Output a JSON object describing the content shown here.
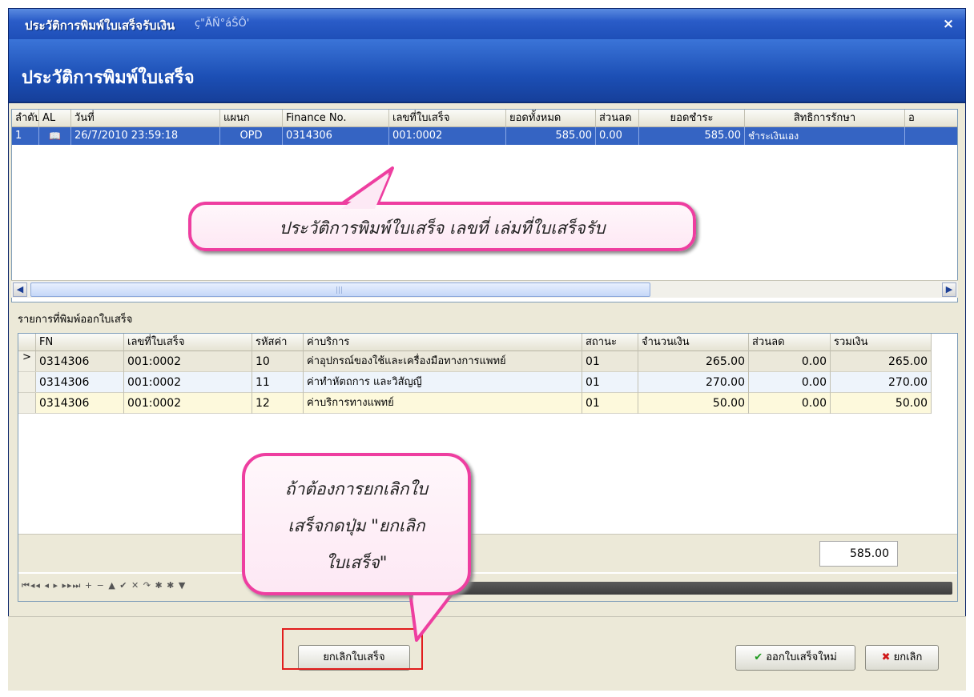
{
  "window": {
    "title": "ประวัติการพิมพ์ใบเสร็จรับเงิน",
    "title_garble": "ç\"ÃÑ°áŠÔ'",
    "header_title": "ประวัติการพิมพ์ใบเสร็จ",
    "close_glyph": "×"
  },
  "history_grid": {
    "columns": [
      "ลำดับ",
      "AL",
      "วันที่",
      "แผนก",
      "Finance No.",
      "เลขที่ใบเสร็จ",
      "ยอดทั้งหมด",
      "ส่วนลด",
      "ยอดชำระ",
      "สิทธิการรักษา",
      "อ"
    ],
    "row": {
      "seq": "1",
      "date": "26/7/2010 23:59:18",
      "dept": "OPD",
      "finance_no": "0314306",
      "receipt_no": "001:0002",
      "total": "585.00",
      "discount": "0.00",
      "paid": "585.00",
      "right": "ชำระเงินเอง"
    }
  },
  "items_label": "รายการที่พิมพ์ออกใบเสร็จ",
  "items_grid": {
    "columns": [
      "FN",
      "เลขที่ใบเสร็จ",
      "รหัสค่าบริก",
      "ค่าบริการ",
      "สถานะ",
      "จำนวนเงิน",
      "ส่วนลด",
      "รวมเงิน"
    ],
    "rows": [
      {
        "fn": "0314306",
        "receipt": "001:0002",
        "code": "10",
        "service": "ค่าอุปกรณ์ของใช้และเครื่องมือทางการแพทย์",
        "status": "01",
        "amount": "265.00",
        "discount": "0.00",
        "total": "265.00"
      },
      {
        "fn": "0314306",
        "receipt": "001:0002",
        "code": "11",
        "service": "ค่าทำหัตถการ และวิสัญญี",
        "status": "01",
        "amount": "270.00",
        "discount": "0.00",
        "total": "270.00"
      },
      {
        "fn": "0314306",
        "receipt": "001:0002",
        "code": "12",
        "service": "ค่าบริการทางแพทย์",
        "status": "01",
        "amount": "50.00",
        "discount": "0.00",
        "total": "50.00"
      }
    ],
    "sum_total": "585.00",
    "nav_glyphs": "⏮◂◂ ◂ ▸ ▸▸⏭ + − ▲ ✔ ✕ ↷ ✱ ✱ ▼"
  },
  "buttons": {
    "cancel_receipt": "ยกเลิกใบเสร็จ",
    "new_receipt": "ออกใบเสร็จใหม่",
    "cancel": "ยกเลิก"
  },
  "callouts": {
    "history": "ประวัติการพิมพ์ใบเสร็จ เลขที่ เล่มที่ใบเสร็จรับ",
    "cancel_hint": [
      "ถ้าต้องการยกเลิกใบ",
      "เสร็จกดปุ่ม \"ยกเลิก",
      "ใบเสร็จ\""
    ]
  },
  "colors": {
    "selection": "#3564c3",
    "callout_border": "#ee3ea0",
    "highlight_frame": "#e11d1d"
  }
}
